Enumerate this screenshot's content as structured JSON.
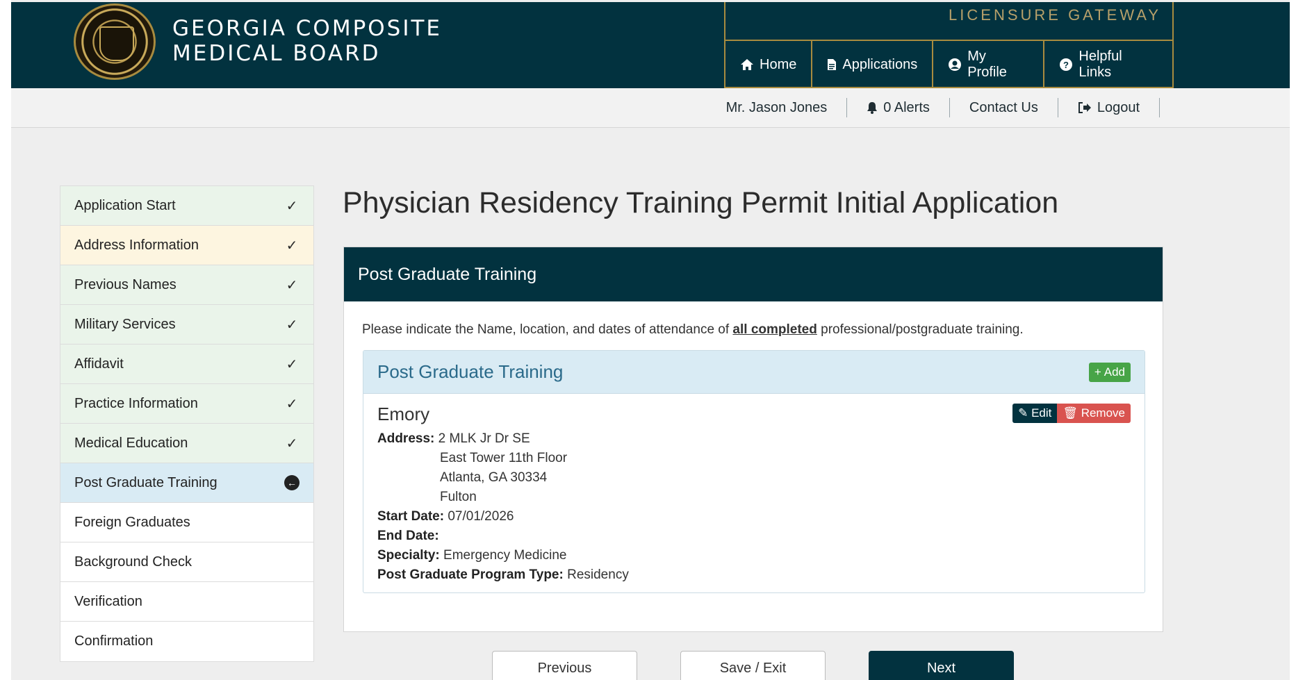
{
  "header": {
    "brand_line1": "GEORGIA COMPOSITE",
    "brand_line2": "MEDICAL BOARD",
    "gateway_title": "LICENSURE GATEWAY",
    "nav": [
      {
        "label": "Home",
        "icon": "home-icon"
      },
      {
        "label": "Applications",
        "icon": "document-icon"
      },
      {
        "label": "My Profile",
        "icon": "user-circle-icon"
      },
      {
        "label": "Helpful Links",
        "icon": "question-circle-icon"
      }
    ]
  },
  "subbar": {
    "user": "Mr. Jason Jones",
    "alerts": "0 Alerts",
    "contact": "Contact Us",
    "logout": "Logout"
  },
  "sidebar": {
    "items": [
      {
        "label": "Application Start",
        "status": "done"
      },
      {
        "label": "Address Information",
        "status": "warn"
      },
      {
        "label": "Previous Names",
        "status": "done"
      },
      {
        "label": "Military Services",
        "status": "done"
      },
      {
        "label": "Affidavit",
        "status": "done"
      },
      {
        "label": "Practice Information",
        "status": "done"
      },
      {
        "label": "Medical Education",
        "status": "done"
      },
      {
        "label": "Post Graduate Training",
        "status": "active"
      },
      {
        "label": "Foreign Graduates",
        "status": "todo"
      },
      {
        "label": "Background Check",
        "status": "todo"
      },
      {
        "label": "Verification",
        "status": "todo"
      },
      {
        "label": "Confirmation",
        "status": "todo"
      }
    ]
  },
  "main": {
    "page_title": "Physician Residency Training Permit Initial Application",
    "panel_title": "Post Graduate Training",
    "intro_before": "Please indicate the Name, location, and dates of attendance of ",
    "intro_emphasis": "all completed",
    "intro_after": " professional/postgraduate training.",
    "card_title": "Post Graduate Training",
    "add_label": "Add",
    "entry": {
      "name": "Emory",
      "edit_label": "Edit",
      "remove_label": "Remove",
      "address_label": "Address:",
      "address_lines": [
        "2 MLK Jr Dr SE",
        "East Tower 11th Floor",
        "Atlanta, GA 30334",
        "Fulton"
      ],
      "start_label": "Start Date:",
      "start_value": "07/01/2026",
      "end_label": "End Date:",
      "end_value": "",
      "specialty_label": "Specialty:",
      "specialty_value": "Emergency Medicine",
      "program_label": "Post Graduate Program Type:",
      "program_value": "Residency"
    }
  },
  "footer": {
    "previous": "Previous",
    "save_exit": "Save / Exit",
    "next": "Next"
  }
}
